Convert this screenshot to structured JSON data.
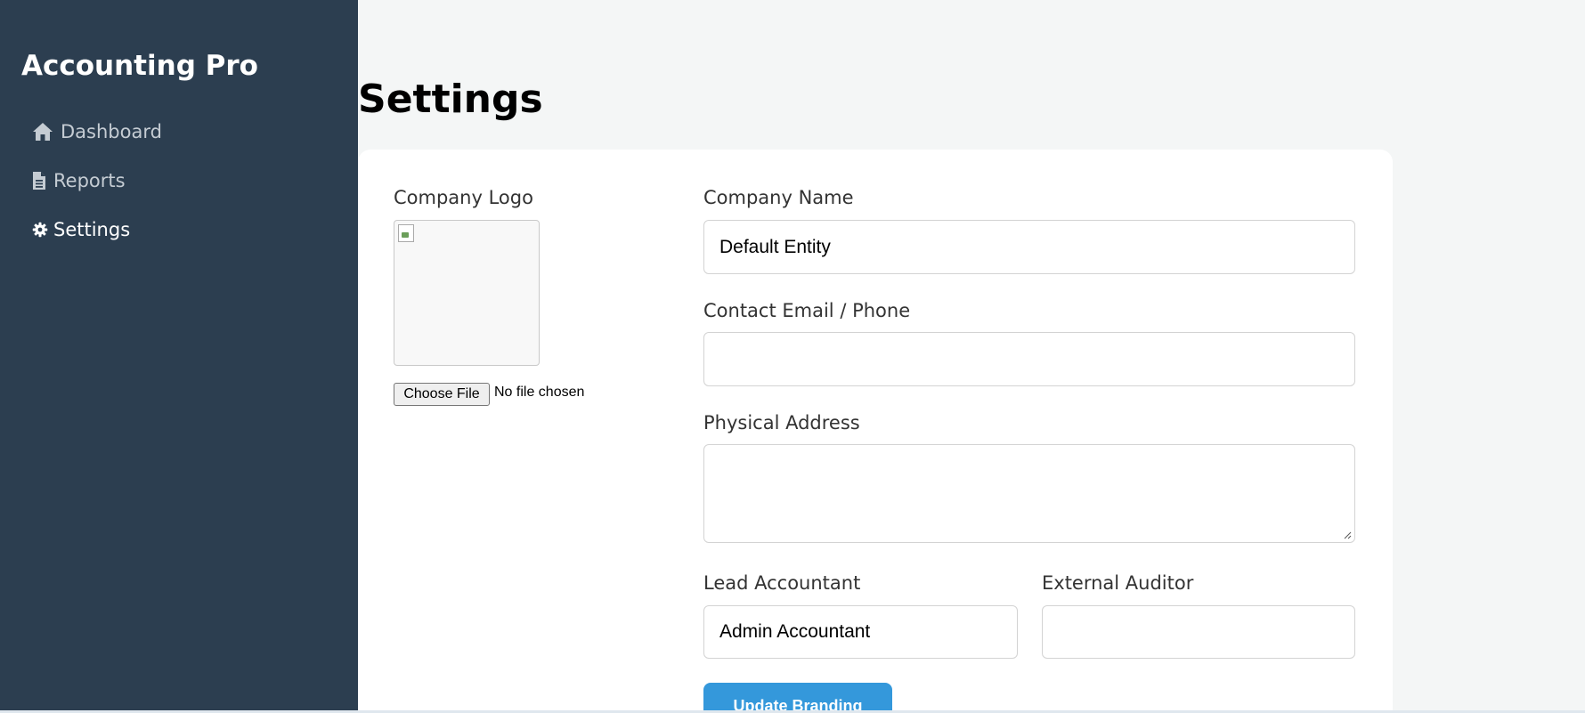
{
  "app": {
    "brand": "Accounting Pro"
  },
  "sidebar": {
    "items": [
      {
        "label": "Dashboard",
        "icon": "home-icon"
      },
      {
        "label": "Reports",
        "icon": "file-icon"
      },
      {
        "label": "Settings",
        "icon": "gear-icon",
        "active": true
      }
    ]
  },
  "page": {
    "title": "Settings"
  },
  "branding": {
    "logo_label": "Company Logo",
    "file_button": "Choose File",
    "file_status": "No file chosen",
    "company_name_label": "Company Name",
    "company_name_value": "Default Entity",
    "contact_label": "Contact Email / Phone",
    "contact_value": "",
    "address_label": "Physical Address",
    "address_value": "",
    "lead_accountant_label": "Lead Accountant",
    "lead_accountant_value": "Admin Accountant",
    "external_auditor_label": "External Auditor",
    "external_auditor_value": "",
    "submit_label": "Update Branding"
  },
  "colors": {
    "sidebar_bg": "#2c3e50",
    "page_bg": "#f4f6f6",
    "primary": "#3498db"
  }
}
